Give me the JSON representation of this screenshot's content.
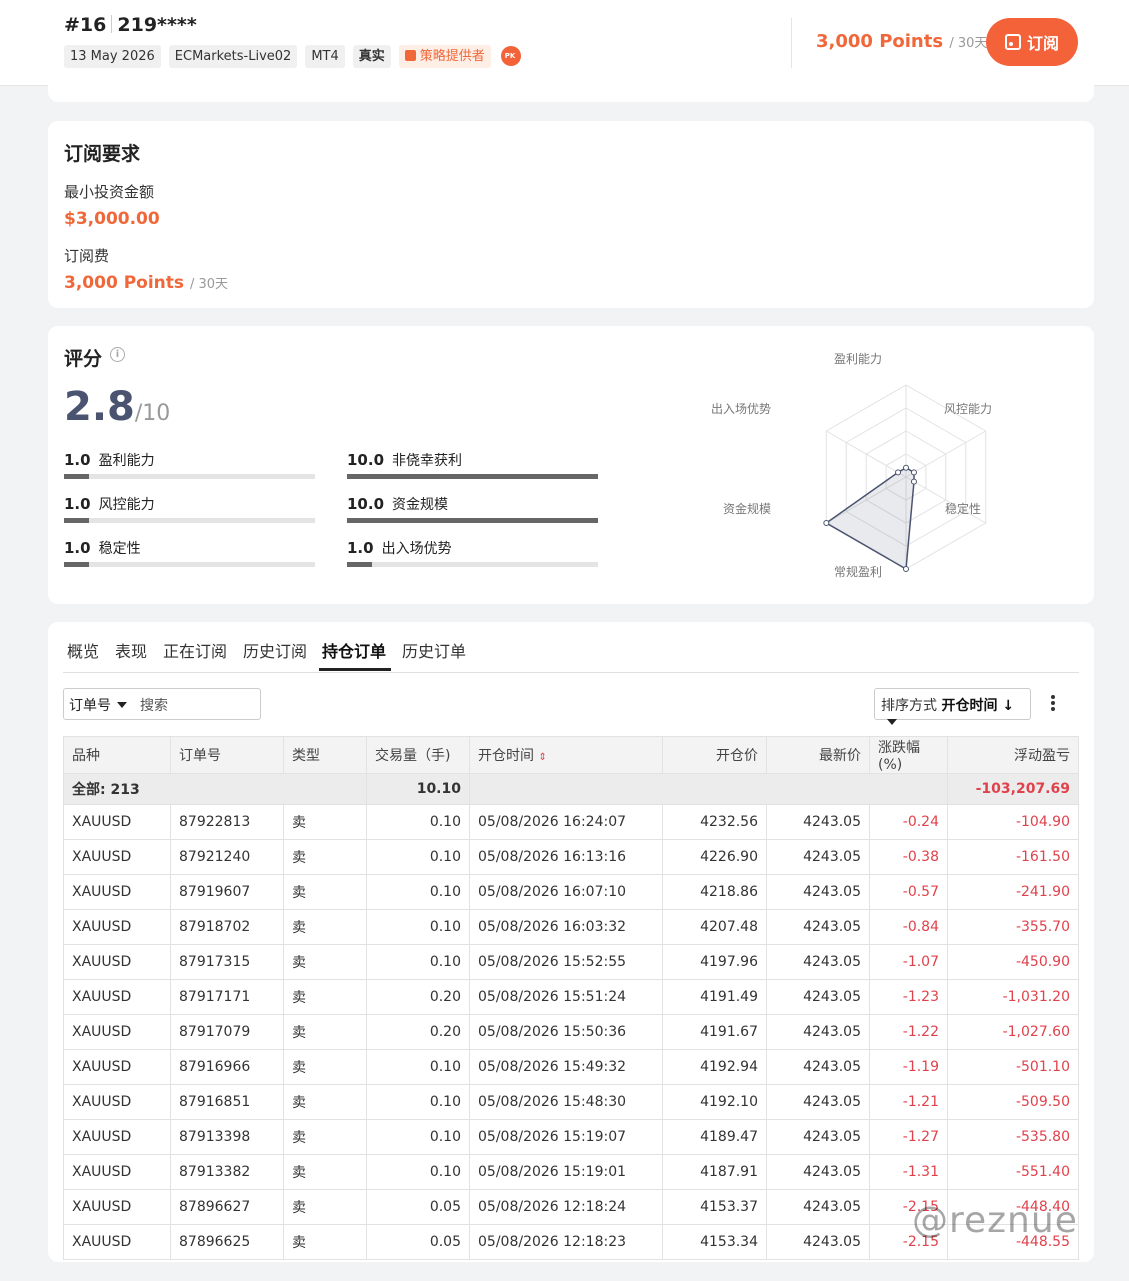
{
  "header": {
    "rank": "#16",
    "account": "219****",
    "tags": [
      "13 May 2026",
      "ECMarkets-Live02",
      "MT4",
      "真实"
    ],
    "provider_tag": "策略提供者",
    "price": "3,000 Points",
    "price_period": "/ 30天",
    "subscribe_label": "订阅"
  },
  "requirements": {
    "title": "订阅要求",
    "min_label": "最小投资金额",
    "min_value": "$3,000.00",
    "fee_label": "订阅费",
    "fee_value": "3,000 Points",
    "fee_period": "/ 30天"
  },
  "score": {
    "title": "评分",
    "value": "2.8",
    "max": "/10",
    "metrics": [
      {
        "value": "1.0",
        "label": "盈利能力",
        "fraction": 0.1
      },
      {
        "value": "10.0",
        "label": "非侥幸获利",
        "fraction": 1.0
      },
      {
        "value": "1.0",
        "label": "风控能力",
        "fraction": 0.1
      },
      {
        "value": "10.0",
        "label": "资金规模",
        "fraction": 1.0
      },
      {
        "value": "1.0",
        "label": "稳定性",
        "fraction": 0.1
      },
      {
        "value": "1.0",
        "label": "出入场优势",
        "fraction": 0.1
      }
    ],
    "radar": {
      "axes": [
        "盈利能力",
        "风控能力",
        "稳定性",
        "常规盈利",
        "资金规模",
        "出入场优势"
      ],
      "values": [
        1,
        1,
        1,
        10,
        10,
        1
      ]
    }
  },
  "orders": {
    "tabs": [
      "概览",
      "表现",
      "正在订阅",
      "历史订阅",
      "持仓订单",
      "历史订单"
    ],
    "active_tab": "持仓订单",
    "filter_select": "订单号",
    "search_placeholder": "搜索",
    "sort_label": "排序方式",
    "sort_value": "开仓时间 ↓",
    "columns": [
      "品种",
      "订单号",
      "类型",
      "交易量（手)",
      "开仓时间",
      "开仓价",
      "最新价",
      "涨跌幅(%)",
      "浮动盈亏"
    ],
    "summary": {
      "label": "全部: 213",
      "volume": "10.10",
      "pnl": "-103,207.69"
    },
    "rows": [
      [
        "XAUUSD",
        "87922813",
        "卖",
        "0.10",
        "05/08/2026 16:24:07",
        "4232.56",
        "4243.05",
        "-0.24",
        "-104.90"
      ],
      [
        "XAUUSD",
        "87921240",
        "卖",
        "0.10",
        "05/08/2026 16:13:16",
        "4226.90",
        "4243.05",
        "-0.38",
        "-161.50"
      ],
      [
        "XAUUSD",
        "87919607",
        "卖",
        "0.10",
        "05/08/2026 16:07:10",
        "4218.86",
        "4243.05",
        "-0.57",
        "-241.90"
      ],
      [
        "XAUUSD",
        "87918702",
        "卖",
        "0.10",
        "05/08/2026 16:03:32",
        "4207.48",
        "4243.05",
        "-0.84",
        "-355.70"
      ],
      [
        "XAUUSD",
        "87917315",
        "卖",
        "0.10",
        "05/08/2026 15:52:55",
        "4197.96",
        "4243.05",
        "-1.07",
        "-450.90"
      ],
      [
        "XAUUSD",
        "87917171",
        "卖",
        "0.20",
        "05/08/2026 15:51:24",
        "4191.49",
        "4243.05",
        "-1.23",
        "-1,031.20"
      ],
      [
        "XAUUSD",
        "87917079",
        "卖",
        "0.20",
        "05/08/2026 15:50:36",
        "4191.67",
        "4243.05",
        "-1.22",
        "-1,027.60"
      ],
      [
        "XAUUSD",
        "87916966",
        "卖",
        "0.10",
        "05/08/2026 15:49:32",
        "4192.94",
        "4243.05",
        "-1.19",
        "-501.10"
      ],
      [
        "XAUUSD",
        "87916851",
        "卖",
        "0.10",
        "05/08/2026 15:48:30",
        "4192.10",
        "4243.05",
        "-1.21",
        "-509.50"
      ],
      [
        "XAUUSD",
        "87913398",
        "卖",
        "0.10",
        "05/08/2026 15:19:07",
        "4189.47",
        "4243.05",
        "-1.27",
        "-535.80"
      ],
      [
        "XAUUSD",
        "87913382",
        "卖",
        "0.10",
        "05/08/2026 15:19:01",
        "4187.91",
        "4243.05",
        "-1.31",
        "-551.40"
      ],
      [
        "XAUUSD",
        "87896627",
        "卖",
        "0.05",
        "05/08/2026 12:18:24",
        "4153.37",
        "4243.05",
        "-2.15",
        "-448.40"
      ],
      [
        "XAUUSD",
        "87896625",
        "卖",
        "0.05",
        "05/08/2026 12:18:23",
        "4153.34",
        "4243.05",
        "-2.15",
        "-448.55"
      ]
    ]
  },
  "watermark": "@reznue",
  "colors": {
    "accent": "#f4623a",
    "negative": "#e0424c",
    "score": "#4a5470"
  }
}
